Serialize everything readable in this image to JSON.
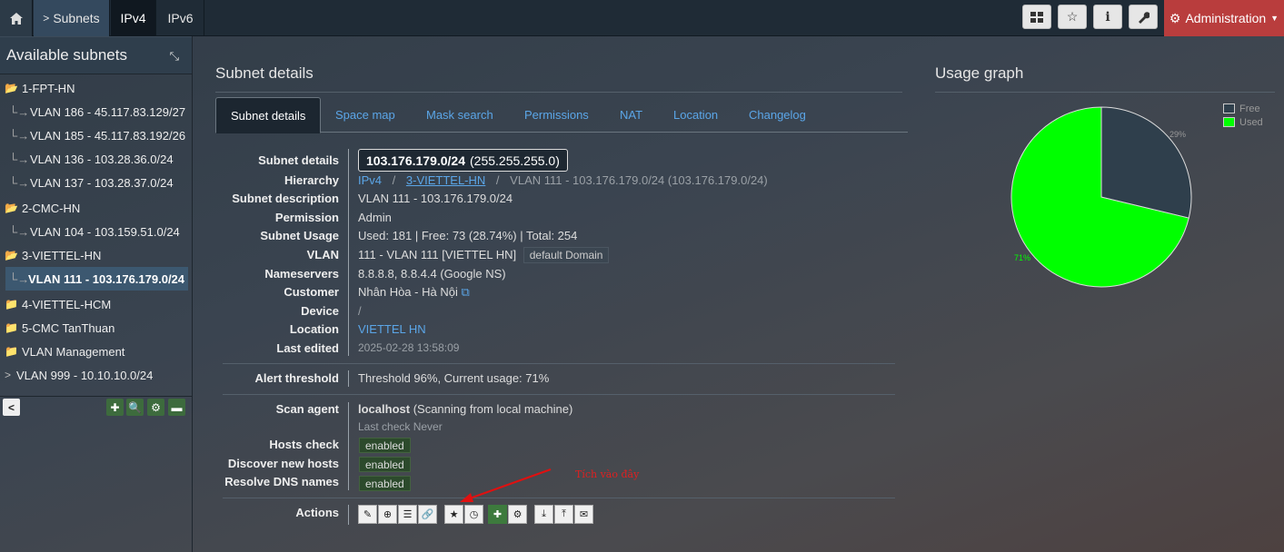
{
  "topbar": {
    "subnets_label": "Subnets",
    "tabs": [
      {
        "label": "IPv4",
        "active": true
      },
      {
        "label": "IPv6",
        "active": false
      }
    ],
    "tools": [
      "dashboard-icon",
      "star-icon",
      "info-icon",
      "wrench-icon"
    ],
    "admin_label": "Administration"
  },
  "sidebar": {
    "title": "Available subnets",
    "groups": [
      {
        "name": "1-FPT-HN",
        "open": true,
        "items": [
          "VLAN 186 - 45.117.83.129/27",
          "VLAN 185 - 45.117.83.192/26",
          "VLAN 136 - 103.28.36.0/24",
          "VLAN 137 - 103.28.37.0/24"
        ]
      },
      {
        "name": "2-CMC-HN",
        "open": true,
        "items": [
          "VLAN 104 - 103.159.51.0/24"
        ]
      },
      {
        "name": "3-VIETTEL-HN",
        "open": true,
        "items": [
          "VLAN 111 - 103.176.179.0/24"
        ]
      },
      {
        "name": "4-VIETTEL-HCM",
        "open": false
      },
      {
        "name": "5-CMC TanThuan",
        "open": false
      },
      {
        "name": "VLAN Management",
        "open": false
      }
    ],
    "standalone": "VLAN 999 - 10.10.10.0/24"
  },
  "main": {
    "title": "Subnet details",
    "tabs": [
      "Subnet details",
      "Space map",
      "Mask search",
      "Permissions",
      "NAT",
      "Location",
      "Changelog"
    ],
    "details": {
      "subnet_details_label": "Subnet details",
      "subnet_main": "103.176.179.0/24",
      "subnet_mask": "(255.255.255.0)",
      "hierarchy_label": "Hierarchy",
      "hierarchy_root": "IPv4",
      "hierarchy_sep": "/",
      "hierarchy_section": "3-VIETTEL-HN",
      "hierarchy_current": "VLAN 111 - 103.176.179.0/24 (103.176.179.0/24)",
      "description_label": "Subnet description",
      "description": "VLAN 111 - 103.176.179.0/24",
      "permission_label": "Permission",
      "permission": "Admin",
      "usage_label": "Subnet Usage",
      "usage": "Used: 181 | Free: 73 (28.74%) | Total: 254",
      "vlan_label": "VLAN",
      "vlan": "111 - VLAN 111 [VIETTEL HN]",
      "vlan_domain": "default Domain",
      "nameservers_label": "Nameservers",
      "nameservers": "8.8.8.8, 8.8.4.4 (Google NS)",
      "customer_label": "Customer",
      "customer": "Nhân Hòa - Hà Nội",
      "device_label": "Device",
      "device": "/",
      "location_label": "Location",
      "location": "VIETTEL HN",
      "last_edited_label": "Last edited",
      "last_edited": "2025-02-28 13:58:09",
      "alert_label": "Alert threshold",
      "alert": "Threshold 96%, Current usage: 71%",
      "scan_agent_label": "Scan agent",
      "scan_agent_name": "localhost",
      "scan_agent_desc": "(Scanning from local machine)",
      "last_check": "Last check Never",
      "hosts_check_label": "Hosts check",
      "discover_label": "Discover new hosts",
      "resolve_label": "Resolve DNS names",
      "enabled": "enabled",
      "actions_label": "Actions"
    },
    "annotation": "Tích vào đây"
  },
  "graph": {
    "title": "Usage graph",
    "legend": [
      {
        "label": "Free",
        "color": "#2f3f4c"
      },
      {
        "label": "Used",
        "color": "#00ff00"
      }
    ],
    "free_label": "29%",
    "used_label": "71%",
    "used_fraction": 0.7126,
    "colors": {
      "used": "#00ff00",
      "free": "#2f3f4c",
      "outline": "#dddddd"
    }
  }
}
